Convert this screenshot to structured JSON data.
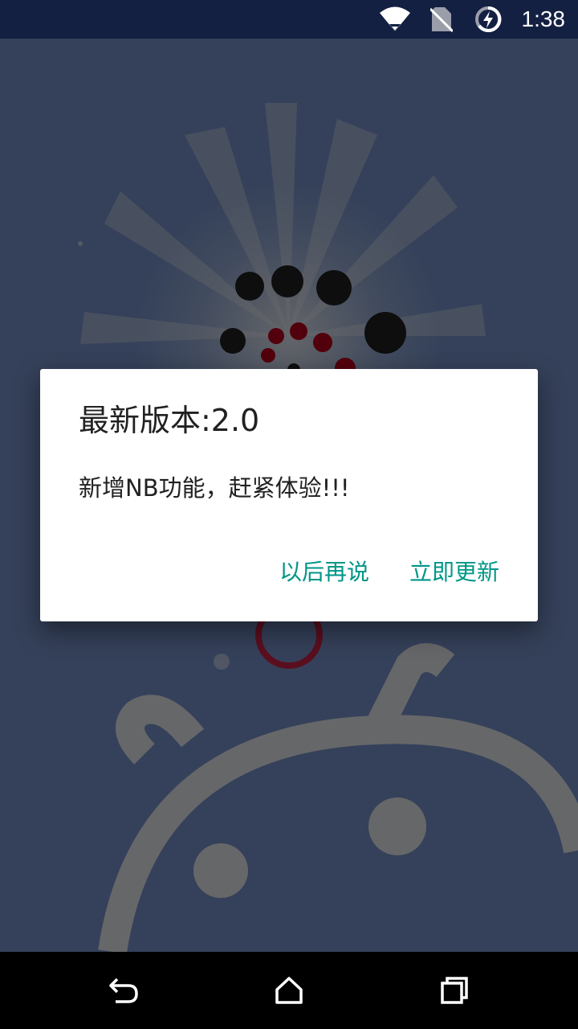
{
  "status_bar": {
    "time": "1:38",
    "icons": [
      "wifi-icon",
      "no-sim-icon",
      "battery-charging-icon"
    ]
  },
  "dialog": {
    "title": "最新版本:2.0",
    "message": "新增NB功能，赶紧体验!!!",
    "negative_button": "以后再说",
    "positive_button": "立即更新",
    "accent_color": "#009688"
  },
  "nav_bar": {
    "icons": [
      "back-icon",
      "home-icon",
      "recents-icon"
    ]
  }
}
